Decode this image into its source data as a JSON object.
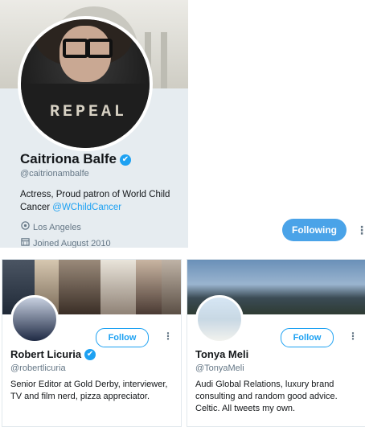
{
  "profile": {
    "name": "Caitriona Balfe",
    "verified_mark": "✔",
    "handle": "@caitrionambalfe",
    "bio_text": "Actress, Proud patron of World Child Cancer ",
    "bio_link": "@WChildCancer",
    "avatar_shirt_text": "REPEAL",
    "location_icon": "location-pin-icon",
    "location": "Los Angeles",
    "joined_icon": "calendar-icon",
    "joined": "Joined August 2010",
    "follow_label": "Following",
    "more_icon": "⋮"
  },
  "suggestions": [
    {
      "name": "Robert Licuria",
      "verified_mark": "✔",
      "handle": "@robertlicuria",
      "bio": "Senior Editor at Gold Derby, interviewer, TV and film nerd, pizza appreciator.",
      "follow_label": "Follow",
      "more_icon": "⋮"
    },
    {
      "name": "Tonya Meli",
      "handle": "@TonyaMeli",
      "bio": "Audi Global Relations, luxury brand consulting and random good advice. Celtic. All tweets my own.",
      "follow_label": "Follow",
      "more_icon": "⋮"
    }
  ],
  "colors": {
    "accent": "#1da1f2",
    "following_button": "#4aa3e8",
    "card_background": "#e6ecf0",
    "secondary_text": "#657786"
  }
}
